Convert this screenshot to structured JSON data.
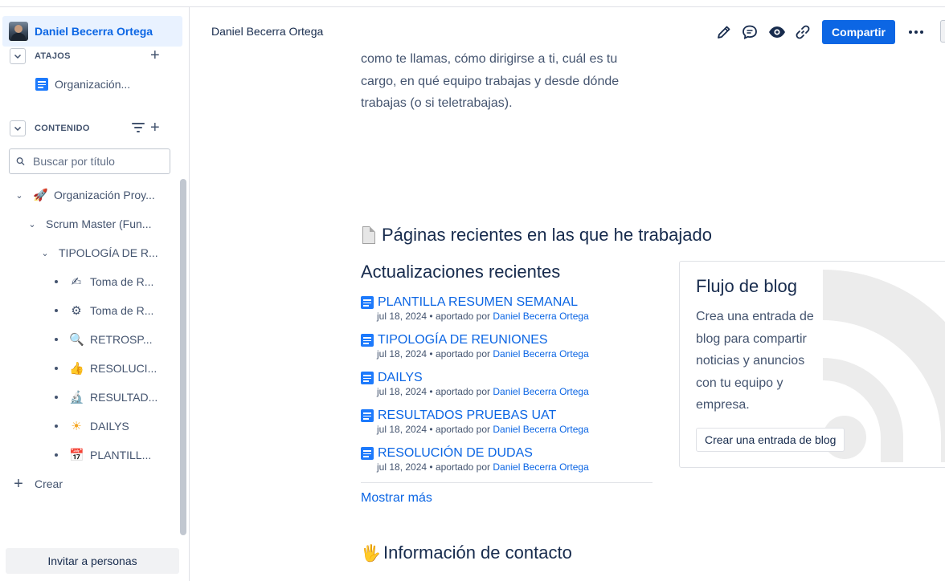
{
  "sidebar": {
    "space_title": "Daniel Becerra Ortega",
    "shortcuts": {
      "label": "ATAJOS",
      "items": [
        {
          "label": "Organización..."
        }
      ]
    },
    "content": {
      "label": "CONTENIDO",
      "search_placeholder": "Buscar por título",
      "tree": [
        {
          "label": "Organización Proy...",
          "icon": "rocket-icon",
          "glyph": "🚀"
        },
        {
          "label": "Scrum Master (Fun..."
        },
        {
          "label": "TIPOLOGÍA DE R..."
        },
        {
          "label": "Toma de R...",
          "icon": "writing-hand-icon",
          "glyph": "✍"
        },
        {
          "label": "Toma de R...",
          "icon": "gear-icon",
          "glyph": "⚙"
        },
        {
          "label": "RETROSP...",
          "icon": "magnifier-icon",
          "glyph": "🔍"
        },
        {
          "label": "RESOLUCI...",
          "icon": "thumbs-up-icon",
          "glyph": "👍"
        },
        {
          "label": "RESULTAD...",
          "icon": "microscope-icon",
          "glyph": "🔬"
        },
        {
          "label": "DAILYS",
          "icon": "sun-icon",
          "glyph": "☀"
        },
        {
          "label": "PLANTILL...",
          "icon": "calendar-icon",
          "glyph": "📅"
        }
      ]
    },
    "create_label": "Crear",
    "invite_label": "Invitar a personas"
  },
  "header": {
    "breadcrumb": "Daniel Becerra Ortega",
    "share_label": "Compartir",
    "icons": [
      "edit-icon",
      "comment-icon",
      "watch-icon",
      "link-icon",
      "more-icon"
    ]
  },
  "main": {
    "intro_text": "como te llamas, cómo dirigirse a ti, cuál es tu cargo, en qué equipo trabajas y desde dónde trabajas (o si teletrabajas).",
    "recent_pages_heading": "Páginas recientes en las que he trabajado",
    "updates_heading": "Actualizaciones recientes",
    "updates": [
      {
        "title": "PLANTILLA RESUMEN SEMANAL",
        "date": "jul 18, 2024",
        "sep": "•",
        "by": "aportado por",
        "author": "Daniel Becerra Ortega"
      },
      {
        "title": "TIPOLOGÍA DE REUNIONES",
        "date": "jul 18, 2024",
        "sep": "•",
        "by": "aportado por",
        "author": "Daniel Becerra Ortega"
      },
      {
        "title": "DAILYS",
        "date": "jul 18, 2024",
        "sep": "•",
        "by": "aportado por",
        "author": "Daniel Becerra Ortega"
      },
      {
        "title": "RESULTADOS PRUEBAS UAT",
        "date": "jul 18, 2024",
        "sep": "•",
        "by": "aportado por",
        "author": "Daniel Becerra Ortega"
      },
      {
        "title": "RESOLUCIÓN DE DUDAS",
        "date": "jul 18, 2024",
        "sep": "•",
        "by": "aportado por",
        "author": "Daniel Becerra Ortega"
      }
    ],
    "show_more": "Mostrar más",
    "contact_heading": "Información de contacto",
    "contact_emoji": "🖐"
  },
  "blog": {
    "title": "Flujo de blog",
    "description": "Crea una entrada de blog para compartir noticias y anuncios con tu equipo y empresa.",
    "button": "Crear una entrada de blog"
  },
  "colors": {
    "accent": "#0c66e4",
    "sidebar_active": "#e9f2ff",
    "text_subtle": "#44546f"
  }
}
